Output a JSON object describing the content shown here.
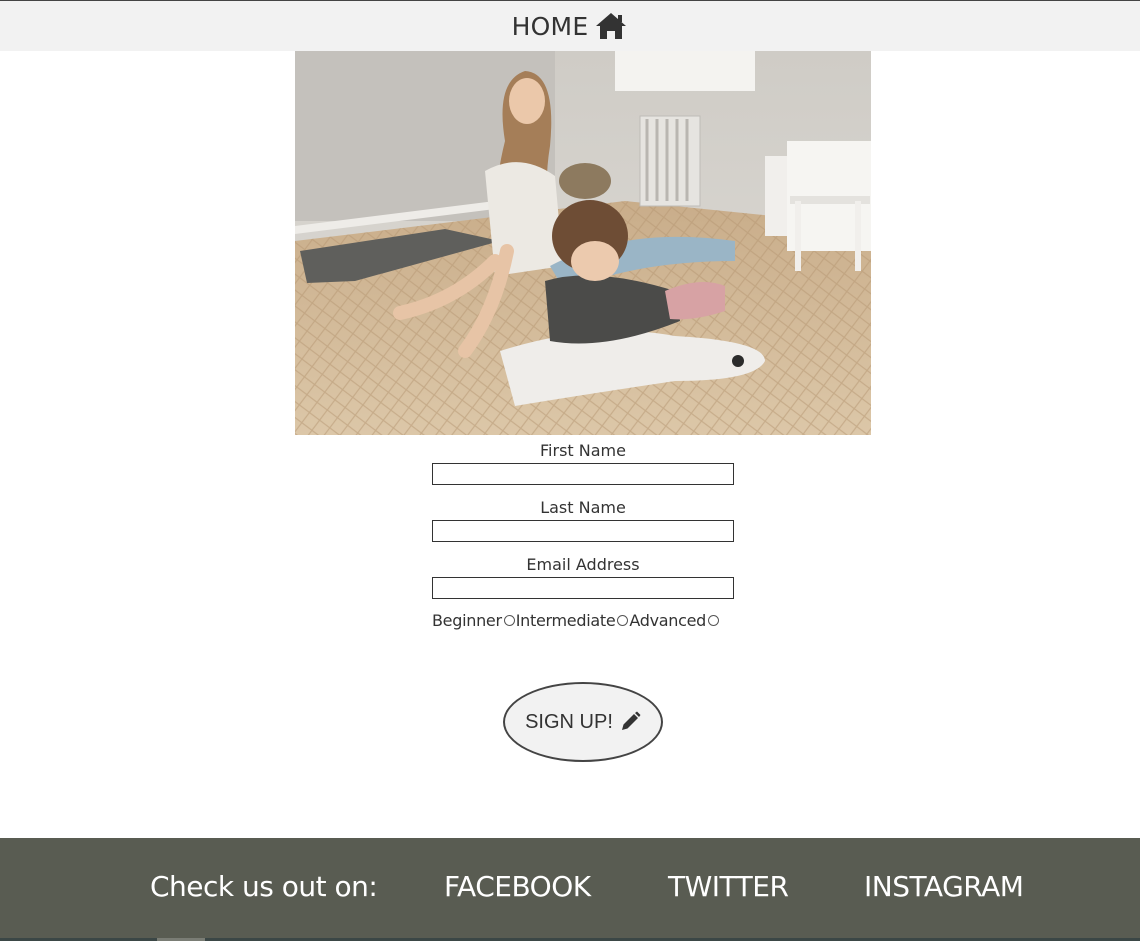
{
  "nav": {
    "home_label": "HOME",
    "home_icon": "home-icon"
  },
  "hero": {
    "image": "photo-woman-and-child-stretching-on-wood-floor"
  },
  "form": {
    "first_name_label": "First Name",
    "first_name_value": "",
    "last_name_label": "Last Name",
    "last_name_value": "",
    "email_label": "Email Address",
    "email_value": "",
    "levels": [
      "Beginner",
      "Intermediate",
      "Advanced"
    ],
    "submit_label": "SIGN UP!",
    "submit_icon": "pencil-icon"
  },
  "footer": {
    "tagline": "Check us out on:",
    "links": [
      "FACEBOOK",
      "TWITTER",
      "INSTAGRAM"
    ]
  },
  "colors": {
    "nav_background": "#f2f2f2",
    "footer_background": "#595c52",
    "text": "#333333"
  }
}
